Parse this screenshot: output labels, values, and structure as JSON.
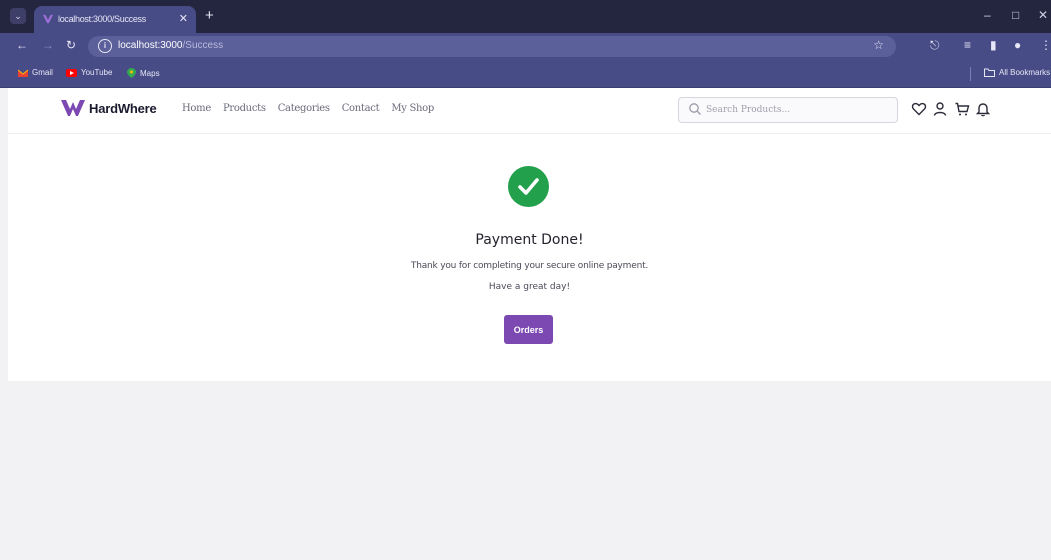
{
  "browser": {
    "tab_title": "localhost:3000/Success",
    "url_host": "localhost:3000",
    "url_path": "/Success",
    "bookmarks": [
      "Gmail",
      "YouTube",
      "Maps"
    ],
    "all_bookmarks_label": "All Bookmarks"
  },
  "navbar": {
    "brand": "HardWhere",
    "links": [
      "Home",
      "Products",
      "Categories",
      "Contact",
      "My Shop"
    ],
    "search_placeholder": "Search Products..."
  },
  "success": {
    "title": "Payment Done!",
    "message": "Thank you for completing your secure online payment.",
    "greeting": "Have a great day!",
    "button_label": "Orders"
  },
  "colors": {
    "accent": "#7c49b2",
    "success": "#22a04b",
    "chrome": "#484c86"
  }
}
